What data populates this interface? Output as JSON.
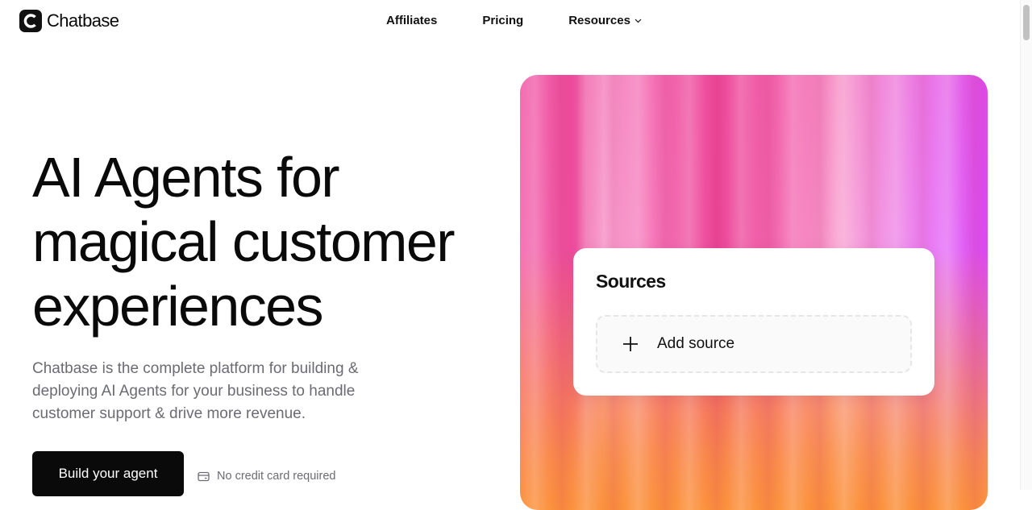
{
  "header": {
    "brand": "Chatbase",
    "nav": [
      {
        "label": "Affiliates"
      },
      {
        "label": "Pricing"
      },
      {
        "label": "Resources"
      }
    ]
  },
  "hero": {
    "title_lines": [
      "AI Agents for",
      "magical customer",
      "experiences"
    ],
    "description": "Chatbase is the complete platform for building & deploying AI Agents for your business to handle customer support & drive more revenue.",
    "cta_label": "Build your agent",
    "note": "No credit card required"
  },
  "visual": {
    "card_title": "Sources",
    "add_source_label": "Add source"
  },
  "colors": {
    "ink": "#0a0a0a",
    "muted": "#6b6b73",
    "panel_pink": "#ec4899",
    "panel_orange": "#fb923c",
    "panel_magenta": "#d946ef"
  },
  "icons": [
    "chatbase-logo-icon",
    "chevron-down-icon",
    "credit-card-icon",
    "plus-icon"
  ]
}
